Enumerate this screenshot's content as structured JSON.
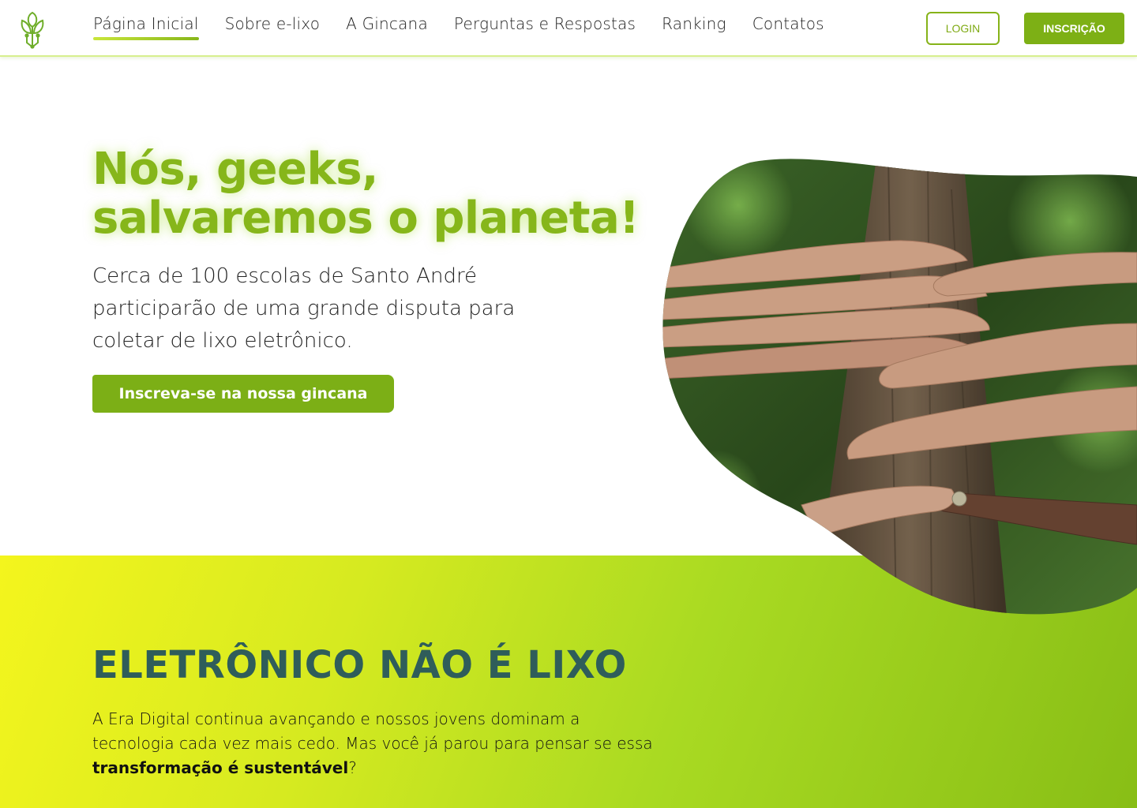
{
  "header": {
    "logo_name": "leaf-circuit-logo",
    "nav": [
      {
        "label": "Página Inicial",
        "active": true
      },
      {
        "label": "Sobre e-lixo",
        "active": false
      },
      {
        "label": "A Gincana",
        "active": false
      },
      {
        "label": "Perguntas e Respostas",
        "active": false
      },
      {
        "label": "Ranking",
        "active": false
      },
      {
        "label": "Contatos",
        "active": false
      }
    ],
    "login_label": "LOGIN",
    "signup_label": "INSCRIÇÃO"
  },
  "hero": {
    "title_line1": "Nós, geeks,",
    "title_line2": "salvaremos o planeta!",
    "description": "Cerca de 100 escolas de Santo André participarão de uma grande disputa para coletar de lixo eletrônico.",
    "cta_label": "Inscreva-se na nossa gincana"
  },
  "section": {
    "title": "ELETRÔNICO NÃO É LIXO",
    "text_before": "A Era Digital continua avançando e nossos jovens dominam a tecnologia cada vez mais cedo. Mas você já parou para pensar se essa ",
    "text_bold": "transformação é sustentável",
    "text_after": "?"
  },
  "colors": {
    "accent": "#86b61a",
    "button": "#7caf16",
    "heading_dark": "#2f5d5a",
    "band_start": "#f4f51d",
    "band_end": "#88be16"
  }
}
